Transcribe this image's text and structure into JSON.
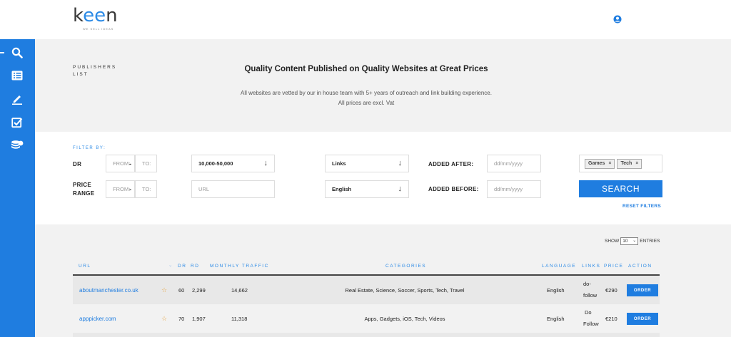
{
  "header": {
    "logo_text_start": "k",
    "logo_text_mid": "ee",
    "logo_text_end": "n",
    "logo_tagline": "WE SELL IDEAS",
    "user_icon": "user-circle-icon"
  },
  "sidebar": {
    "items": [
      {
        "icon": "search-icon"
      },
      {
        "icon": "list-icon"
      },
      {
        "icon": "edit-icon"
      },
      {
        "icon": "checkbox-icon"
      },
      {
        "icon": "coins-icon"
      }
    ],
    "collapse_label": "→"
  },
  "hero": {
    "section_label_line1": "PUBLISHERS",
    "section_label_line2": "LIST",
    "title": "Quality Content Published on Quality Websites at Great Prices",
    "subtitle_line1": "All websites are vetted by our in house team with 5+ years of outreach and link building experience.",
    "subtitle_line2": "All prices are excl. Vat"
  },
  "filter": {
    "heading": "FILTER BY:",
    "dr_label": "DR",
    "price_label_line1": "PRICE",
    "price_label_line2": "RANGE",
    "from_placeholder": "FROM:",
    "to_placeholder": "TO:",
    "traffic_value": "10,000-50,000",
    "url_placeholder": "URL",
    "links_value": "Links",
    "language_value": "English",
    "added_after_label": "ADDED AFTER:",
    "added_before_label": "ADDED BEFORE:",
    "date_placeholder": "dd/mm/yyyy",
    "tags": [
      "Games",
      "Tech"
    ],
    "tag_remove": "×",
    "search_button": "SEARCH",
    "reset_link": "RESET FILTERS",
    "arrow": "↓"
  },
  "table": {
    "show_label": "SHOW",
    "entries_value": "10",
    "entries_label": "ENTRIES",
    "columns": {
      "url": "URL",
      "sort": "⌄",
      "dr": "DR",
      "rd": "RD",
      "traffic": "MONTHLY TRAFFIC",
      "categories": "CATEGORIES",
      "language": "LANGUAGE",
      "links": "LINKS",
      "price": "PRICE",
      "action": "ACTION"
    },
    "rows": [
      {
        "url": "aboutmanchester.co.uk",
        "star": "☆",
        "dr": "60",
        "rd": "2,299",
        "traffic": "14,662",
        "categories": "Real Estate, Science, Soccer, Sports, Tech, Travel",
        "language": "English",
        "links_line1": "do-",
        "links_line2": "follow",
        "price": "€290",
        "action": "ORDER"
      },
      {
        "url": "apppicker.com",
        "star": "☆",
        "dr": "70",
        "rd": "1,907",
        "traffic": "11,318",
        "categories": "Apps, Gadgets, iOS, Tech, Videos",
        "language": "English",
        "links_line1": "Do",
        "links_line2": "Follow",
        "price": "€210",
        "action": "ORDER"
      }
    ]
  }
}
